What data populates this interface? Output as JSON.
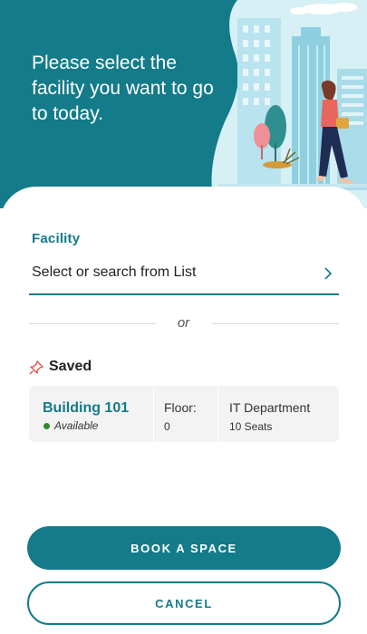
{
  "header": {
    "title": "Please select the facility you want to go to today."
  },
  "facility": {
    "label": "Facility",
    "placeholder": "Select or search from List"
  },
  "divider": {
    "text": "or"
  },
  "saved": {
    "title": "Saved",
    "items": [
      {
        "building": "Building 101",
        "status": "Available",
        "floor_label": "Floor:",
        "floor_value": "0",
        "department": "IT Department",
        "seats": "10 Seats"
      }
    ]
  },
  "actions": {
    "book_label": "BOOK A SPACE",
    "cancel_label": "CANCEL"
  },
  "colors": {
    "primary": "#137b89",
    "available": "#2e8b2e",
    "pin": "#e24b4b"
  }
}
